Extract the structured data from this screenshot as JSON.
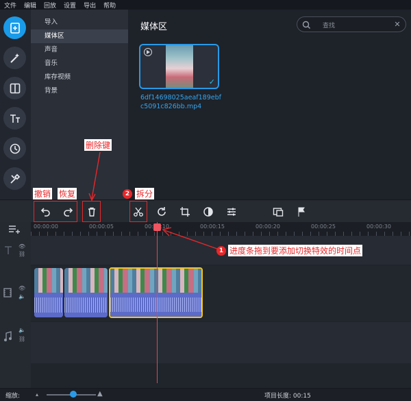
{
  "menu": [
    "文件",
    "编辑",
    "回放",
    "设置",
    "导出",
    "帮助"
  ],
  "categories": [
    "导入",
    "媒体区",
    "声音",
    "音乐",
    "库存视频",
    "背景"
  ],
  "selected_category": "媒体区",
  "media": {
    "title": "媒体区",
    "search_placeholder": "查找",
    "file_name": "6df14698025aeaf189ebfc5091c826bb.mp4"
  },
  "ruler_ticks": [
    "00:00:00",
    "00:00:05",
    "00:00:10",
    "00:00:15",
    "00:00:20",
    "00:00:25",
    "00:00:30"
  ],
  "status": {
    "zoom_label": "缩放:",
    "project_length": "项目长度: 00:15"
  },
  "annotations": {
    "delete_key": "删除键",
    "undo": "撤销",
    "redo": "恢复",
    "split_num": "2",
    "split": "拆分",
    "playhead_num": "1",
    "playhead_note": "进度条拖到要添加切换特效的时间点"
  },
  "colors": {
    "accent": "#1a9bea",
    "annotation_red": "#e8272a",
    "clip_selected": "#f5c518",
    "playhead": "#e8454f"
  }
}
